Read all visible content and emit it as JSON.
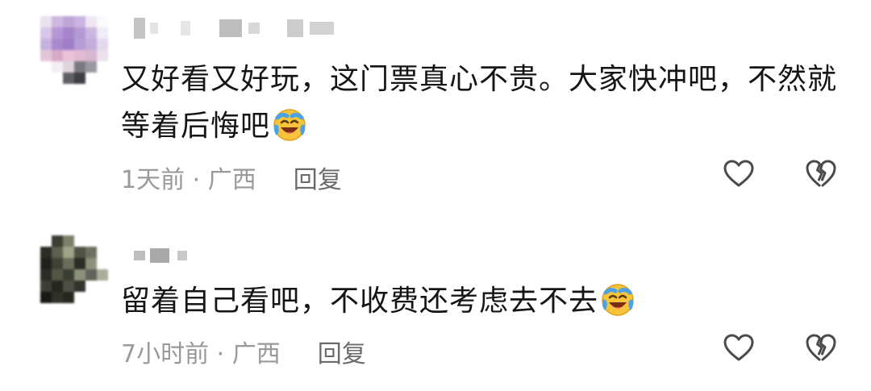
{
  "comments": [
    {
      "text_line1": "又好看又好玩，这门票真心不贵。大家快冲吧，不然就",
      "text_line2": "等着后悔吧",
      "emoji": "laughing-crying-emoji",
      "time_location": "1天前 · 广西",
      "reply_label": "回复",
      "like_icon": "heart-outline-icon",
      "dislike_icon": "broken-heart-icon"
    },
    {
      "text_line1": "留着自己看吧，不收费还考虑去不去",
      "emoji": "laughing-crying-emoji",
      "time_location": "7小时前 · 广西",
      "reply_label": "回复",
      "like_icon": "heart-outline-icon",
      "dislike_icon": "broken-heart-icon"
    }
  ],
  "colors": {
    "text": "#151515",
    "meta": "#999999",
    "reply": "#6a6a6a",
    "icon_stroke": "#4a4a4a",
    "emoji_face": "#f7c43a",
    "emoji_tear": "#4aa3e8"
  }
}
